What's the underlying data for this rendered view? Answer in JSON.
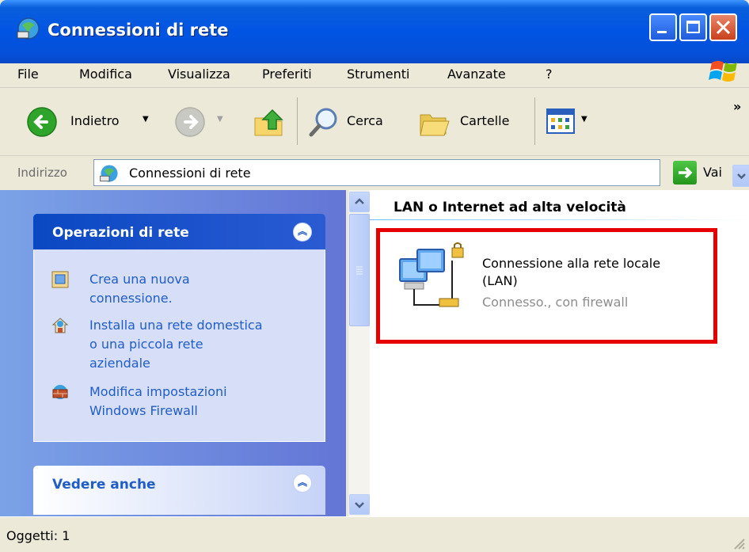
{
  "window": {
    "title": "Connessioni di rete"
  },
  "menu": {
    "items": [
      "File",
      "Modifica",
      "Visualizza",
      "Preferiti",
      "Strumenti",
      "Avanzate",
      "?"
    ]
  },
  "toolbar": {
    "back_label": "Indietro",
    "search_label": "Cerca",
    "folders_label": "Cartelle",
    "more_glyph": "»"
  },
  "address": {
    "label": "Indirizzo",
    "value": "Connessioni di rete",
    "go_label": "Vai"
  },
  "taskpane": {
    "network_tasks": {
      "title": "Operazioni di rete",
      "items": [
        {
          "label_lines": [
            "Crea una nuova",
            "connessione."
          ],
          "icon": "new-connection-icon"
        },
        {
          "label_lines": [
            "Installa una rete domestica",
            "o una piccola rete",
            "aziendale"
          ],
          "icon": "home-network-icon"
        },
        {
          "label_lines": [
            "Modifica impostazioni",
            "Windows Firewall"
          ],
          "icon": "firewall-icon"
        }
      ]
    },
    "see_also": {
      "title": "Vedere anche"
    }
  },
  "content": {
    "group_header": "LAN o Internet ad alta velocità",
    "connection": {
      "name_line1": "Connessione alla rete locale",
      "name_line2": "(LAN)",
      "status": "Connesso., con firewall"
    }
  },
  "statusbar": {
    "text": "Oggetti: 1"
  },
  "colors": {
    "titlebar": "#0054e3",
    "task_link": "#215dc6",
    "highlight_border": "#e60000"
  }
}
